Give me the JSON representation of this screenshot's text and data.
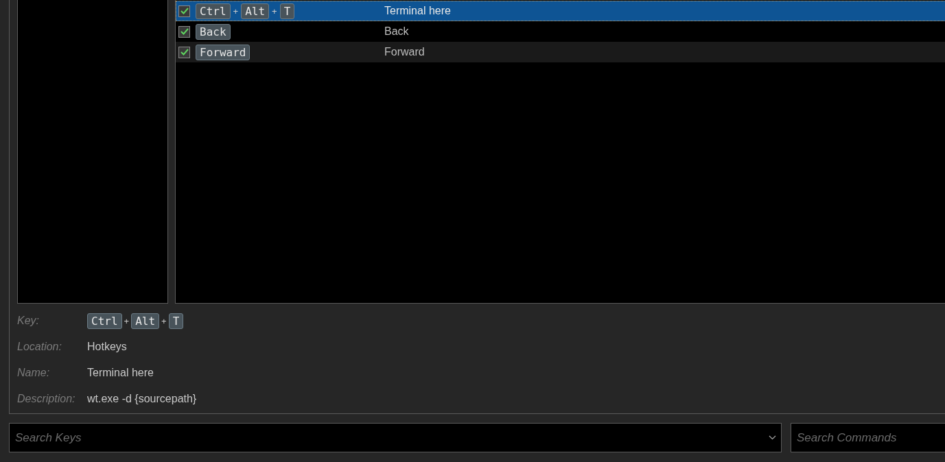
{
  "shortcuts": [
    {
      "checked": true,
      "selected": true,
      "keys": [
        {
          "kind": "key",
          "text": "Ctrl"
        },
        {
          "kind": "plus",
          "text": "+"
        },
        {
          "kind": "key",
          "text": "Alt"
        },
        {
          "kind": "plus",
          "text": "+"
        },
        {
          "kind": "key",
          "text": "T"
        }
      ],
      "command": "Terminal here"
    },
    {
      "checked": true,
      "selected": false,
      "keys": [
        {
          "kind": "key",
          "text": "Back"
        }
      ],
      "command": "Back"
    },
    {
      "checked": true,
      "selected": false,
      "keys": [
        {
          "kind": "key",
          "text": "Forward"
        }
      ],
      "command": "Forward"
    }
  ],
  "details": [
    {
      "kind": "keys",
      "label": "Key:",
      "keys": [
        {
          "kind": "key",
          "text": "Ctrl"
        },
        {
          "kind": "plus",
          "text": "+"
        },
        {
          "kind": "key",
          "text": "Alt"
        },
        {
          "kind": "plus",
          "text": "+"
        },
        {
          "kind": "key",
          "text": "T"
        }
      ]
    },
    {
      "kind": "text",
      "label": "Location:",
      "value": "Hotkeys"
    },
    {
      "kind": "text",
      "label": "Name:",
      "value": "Terminal here"
    },
    {
      "kind": "text",
      "label": "Description:",
      "value": "wt.exe -d {sourcepath}"
    }
  ],
  "search_keys": {
    "placeholder": "Search Keys"
  },
  "search_commands": {
    "placeholder": "Search Commands"
  }
}
